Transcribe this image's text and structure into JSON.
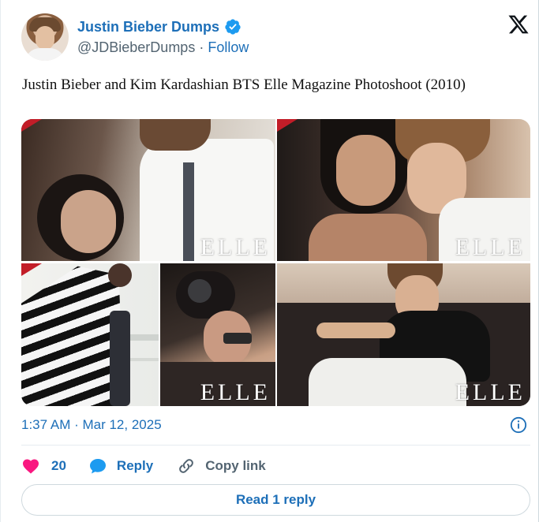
{
  "author": {
    "display_name": "Justin Bieber Dumps",
    "handle": "@JDBieberDumps",
    "separator": " · ",
    "follow_label": "Follow",
    "verified": true
  },
  "tweet": {
    "text": "Justin Bieber and Kim Kardashian BTS Elle Magazine Photoshoot (2010)"
  },
  "media": {
    "images": [
      {
        "watermark": "ELLE",
        "description": "man with tie leaning over smiling woman"
      },
      {
        "watermark": "ELLE",
        "description": "woman and young man close-up"
      },
      {
        "watermark": "",
        "description": "woman in striped cardigan on balcony"
      },
      {
        "watermark": "ELLE",
        "description": "photographer holding camera"
      },
      {
        "watermark": "ELLE",
        "description": "young man sitting holding sunglasses"
      }
    ]
  },
  "meta": {
    "timestamp": "1:37 AM · Mar 12, 2025"
  },
  "actions": {
    "like_count": "20",
    "reply_label": "Reply",
    "copy_label": "Copy link"
  },
  "read_reply_label": "Read 1 reply",
  "colors": {
    "link_blue": "#1d6fb8",
    "like_red": "#f91880",
    "muted": "#536471",
    "verified": "#1d9bf0"
  },
  "icons": {
    "verified": "verified-badge-icon",
    "logo": "x-logo-icon",
    "info": "info-icon",
    "like": "heart-icon",
    "reply": "speech-bubble-icon",
    "copy": "link-icon"
  }
}
